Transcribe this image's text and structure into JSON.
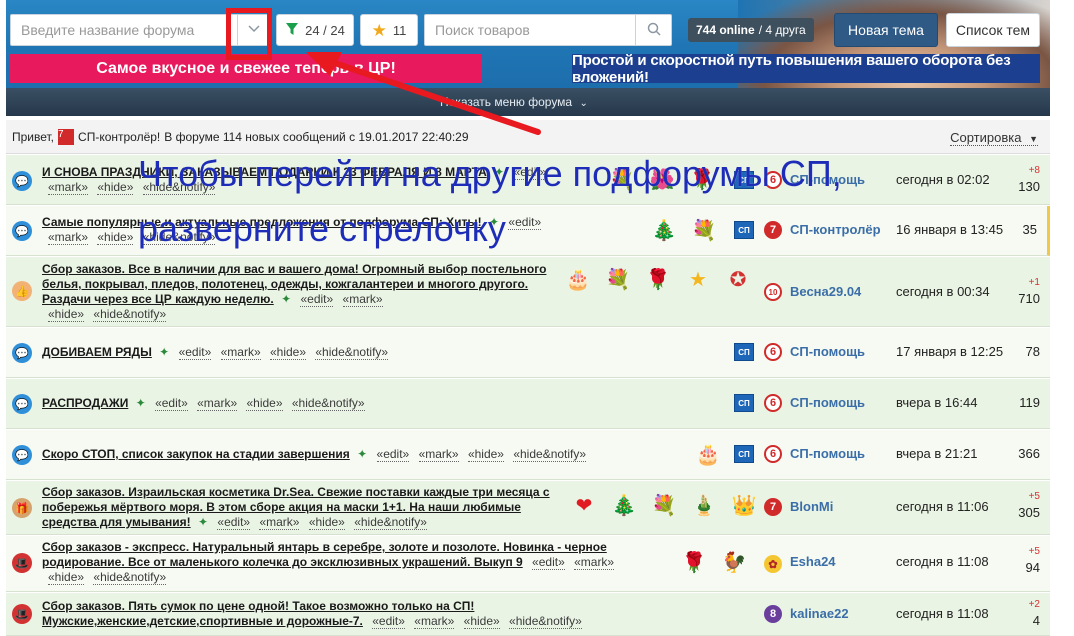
{
  "header": {
    "forum_placeholder": "Введите название форума",
    "filter_count": "24 / 24",
    "favorites_count": "11",
    "search_placeholder": "Поиск товаров",
    "online_count": "744 online",
    "friends": "/ 4 друга",
    "new_topic": "Новая тема",
    "topic_list": "Список тем",
    "banner_left": "Самое вкусное и свежее теперь в ЦР!",
    "banner_right": "Простой и скоростной путь повышения вашего оборота без вложений!",
    "menu_toggle": "Показать меню форума",
    "colors": {
      "header_blue": "#1f74b3",
      "pink": "#e8195c",
      "navy": "#1c3f8f",
      "new_topic_bg": "#2f5a86"
    }
  },
  "infobar": {
    "greeting": "Привет,",
    "user": "СП-контролёр!",
    "message": "В форуме 114 новых сообщений с 19.01.2017 22:40:29",
    "sort_label": "Сортировка"
  },
  "annotation": {
    "line1": "Чтобы перейти на другие подфорумы СП,",
    "line2": "разверните стрелочку"
  },
  "actions": {
    "edit": "«edit»",
    "mark": "«mark»",
    "hide": "«hide»",
    "notify": "«hide&notify»"
  },
  "topics": [
    {
      "title": "И СНОВА ПРАЗДНИКИ, ЗАКАЗЫВАЕМ ПОДАРКИ К 23 ФЕВРАЛЯ И 8 МАРТА",
      "author": "СП-помощь",
      "date": "сегодня в 02:02",
      "plus": "+8",
      "count": "130"
    },
    {
      "title": "Самые популярные и актуальные предложения от подфорума СП: Хиты!",
      "author": "СП-контролёр",
      "date": "16 января в 13:45",
      "plus": "",
      "count": "35"
    },
    {
      "title": "Сбор заказов. Все в наличии для вас и вашего дома! Огромный выбор постельного белья, покрывал, пледов, полотенец, одежды, кожгалантереи и многого другого. Раздачи через все ЦР каждую неделю.",
      "author": "Весна29.04",
      "date": "сегодня в 00:34",
      "plus": "+1",
      "count": "710"
    },
    {
      "title": "ДОБИВАЕМ РЯДЫ",
      "author": "СП-помощь",
      "date": "17 января в 12:25",
      "plus": "",
      "count": "78"
    },
    {
      "title": "РАСПРОДАЖИ",
      "author": "СП-помощь",
      "date": "вчера в 16:44",
      "plus": "",
      "count": "119"
    },
    {
      "title": "Скоро СТОП, список закупок на стадии завершения",
      "author": "СП-помощь",
      "date": "вчера в 21:21",
      "plus": "",
      "count": "366"
    },
    {
      "title": "Сбор заказов. Израильская косметика Dr.Sea. Свежие поставки каждые три месяца с побережья мёртвого моря. В этом сборе акция на маски 1+1. На наши любимые средства для умывания!",
      "author": "BlonMi",
      "date": "сегодня в 11:06",
      "plus": "+5",
      "count": "305"
    },
    {
      "title": "Сбор заказов - экспресс. Натуральный янтарь в серебре, золоте и позолоте. Новинка - черное родирование. Все от маленького колечка до эксклюзивных украшений. Выкуп 9",
      "author": "Esha24",
      "date": "сегодня в 11:08",
      "plus": "+5",
      "count": "94"
    },
    {
      "title": "Сбор заказов. Пять сумок по цене одной! Такое возможно только на СП! Мужские,женские,детские,спортивные и дорожные-7.",
      "author": "kalinae22",
      "date": "сегодня в 11:08",
      "plus": "+2",
      "count": "4"
    }
  ],
  "icons": {
    "filter": "funnel-icon",
    "favorites": "star-icon",
    "search": "magnifier-icon",
    "dropdown": "chevron-down-icon",
    "sort": "caret-down-icon"
  }
}
